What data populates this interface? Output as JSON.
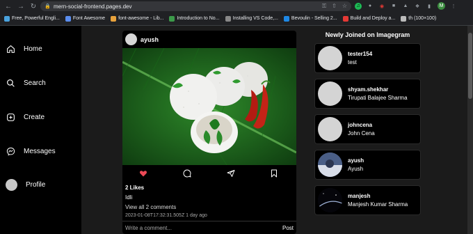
{
  "browser": {
    "url": "mern-social-frontend.pages.dev",
    "bookmarks": [
      {
        "label": "Free, Powerful Engli...",
        "color": "#4aa3df"
      },
      {
        "label": "Font Awesome",
        "color": "#5a8dee"
      },
      {
        "label": "font-awesome - Lib...",
        "color": "#e8a23c"
      },
      {
        "label": "Introduction to No...",
        "color": "#3c9a4a"
      },
      {
        "label": "Installing VS Code,...",
        "color": "#888888"
      },
      {
        "label": "Bevoulin - Selling 2...",
        "color": "#1e88e5"
      },
      {
        "label": "Build and Deploy a...",
        "color": "#e53935"
      },
      {
        "label": "th (100×100)",
        "color": "#bbbbbb"
      }
    ],
    "profile_initial": "M"
  },
  "sidebar": {
    "items": [
      {
        "label": "Home",
        "icon": "home-icon"
      },
      {
        "label": "Search",
        "icon": "search-icon"
      },
      {
        "label": "Create",
        "icon": "plus-square-icon"
      },
      {
        "label": "Messages",
        "icon": "messenger-icon"
      },
      {
        "label": "Profile",
        "icon": "avatar"
      }
    ]
  },
  "post": {
    "username": "ayush",
    "likes": "2 Likes",
    "caption": "Idli",
    "comments_link": "View all 2 comments",
    "timestamp": "2023-01-08T17:32:31.505Z 1 day ago",
    "comment_placeholder": "Write a comment...",
    "post_label": "Post",
    "like_color": "#ed4956"
  },
  "right": {
    "title": "Newly Joined on Imagegram",
    "users": [
      {
        "username": "tester154",
        "name": "test"
      },
      {
        "username": "shyam.shekhar",
        "name": "Tirupati Balajee Sharma"
      },
      {
        "username": "johncena",
        "name": "John Cena"
      },
      {
        "username": "ayush",
        "name": "Ayush"
      },
      {
        "username": "manjesh",
        "name": "Manjesh Kumar Sharma"
      }
    ]
  }
}
